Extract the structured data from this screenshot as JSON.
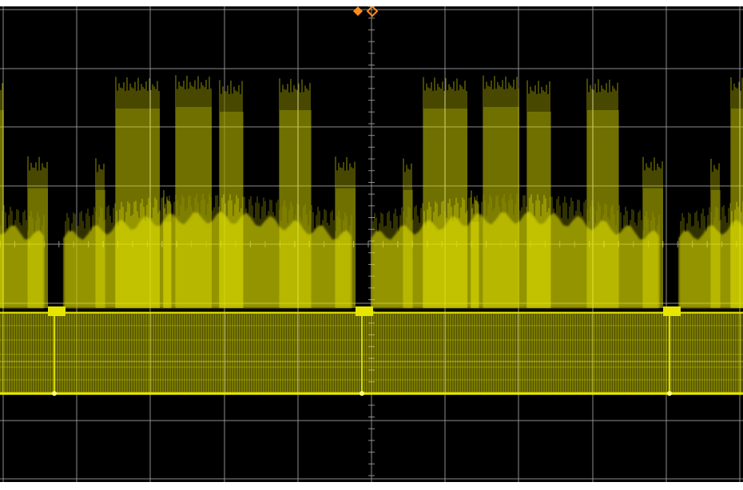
{
  "display": {
    "background": "#000000",
    "grid_color": "#9a9a9a",
    "trace_color": "#e6e600",
    "marker_color": "#ff8c1a",
    "h_divisions": 10,
    "v_divisions": 8
  },
  "markers": {
    "trigger_position_icon": "orange-diamond-icon",
    "time_reference_icon": "orange-hollow-diamond-icon"
  }
}
